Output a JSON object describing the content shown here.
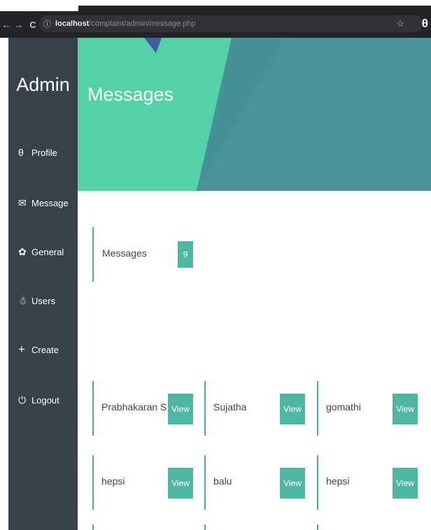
{
  "browser": {
    "back_icon": "←",
    "forward_icon": "→",
    "reload_icon": "C",
    "info_icon": "ⓘ",
    "url_host": "localhost",
    "url_path": "/complaint/admin/message.php",
    "star_icon": "☆",
    "profile_icon": "θ"
  },
  "sidebar": {
    "brand": "Admin",
    "items": [
      {
        "label": "Profile",
        "icon": "user-icon",
        "glyph": "θ"
      },
      {
        "label": "Message",
        "icon": "envelope-icon",
        "glyph": "✉"
      },
      {
        "label": "General",
        "icon": "gear-icon",
        "glyph": "✿"
      },
      {
        "label": "Users",
        "icon": "users-icon",
        "glyph": "☃"
      },
      {
        "label": "Create",
        "icon": "plus-icon",
        "glyph": "+"
      },
      {
        "label": "Logout",
        "icon": "power-icon",
        "glyph": "⏻"
      }
    ]
  },
  "header": {
    "title": "Messages"
  },
  "counter": {
    "label": "Messages",
    "count": "9"
  },
  "messages": [
    {
      "name": "Prabhakaran S",
      "button": "View"
    },
    {
      "name": "Sujatha",
      "button": "View"
    },
    {
      "name": "gomathi",
      "button": "View"
    },
    {
      "name": "hepsi",
      "button": "View"
    },
    {
      "name": "balu",
      "button": "View"
    },
    {
      "name": "hepsi",
      "button": "View"
    }
  ],
  "colors": {
    "sidebar": "#37424a",
    "header_teal": "#4c949c",
    "header_mint": "#55d2aa",
    "accent": "#4fb6a4",
    "browser": "#222427"
  }
}
